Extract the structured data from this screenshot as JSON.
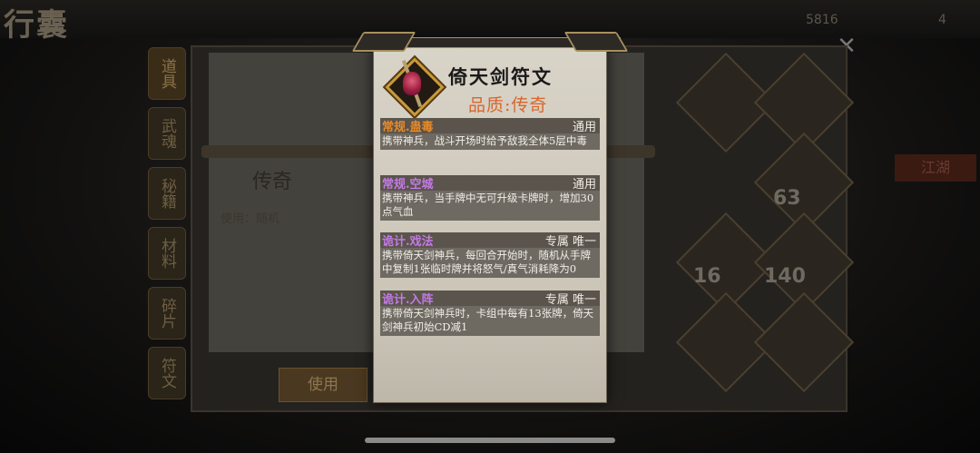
{
  "background": {
    "title": "行囊",
    "counter_value": "5816",
    "counter_value_2": "4",
    "tabs": [
      "道具",
      "武魂",
      "秘籍",
      "材料",
      "碎片",
      "符文"
    ],
    "item_name": "传奇",
    "item_use_text": "使用：随机",
    "use_button": "使用",
    "side_label": "江湖",
    "counts": [
      "63",
      "16",
      "140"
    ]
  },
  "card": {
    "title": "倚天剑符文",
    "quality": "品质:传奇",
    "skills": [
      {
        "name": "常规.蛊毒",
        "tag": "通用",
        "description": "携带神兵，战斗开场时给予敌我全体5层中毒",
        "name_color": "#e88a2a"
      },
      {
        "name": "常规.空城",
        "tag": "通用",
        "description": "携带神兵，当手牌中无可升级卡牌时，增加30点气血",
        "name_color": "#c47ae6"
      },
      {
        "name": "诡计.戏法",
        "tag": "专属 唯一",
        "description": "携带倚天剑神兵，每回合开始时，随机从手牌中复制1张临时牌并将怒气/真气消耗降为0",
        "name_color": "#c47ae6"
      },
      {
        "name": "诡计.入阵",
        "tag": "专属 唯一",
        "description": "携带倚天剑神兵时，卡组中每有13张牌，倚天剑神兵初始CD减1",
        "name_color": "#c47ae6"
      }
    ]
  },
  "icons": {
    "item": "rune-gem-icon",
    "close": "close-icon"
  },
  "colors": {
    "quality": "#d8662c",
    "card_bg": "#d9d4c8",
    "skill_body": "#6e6a62"
  }
}
